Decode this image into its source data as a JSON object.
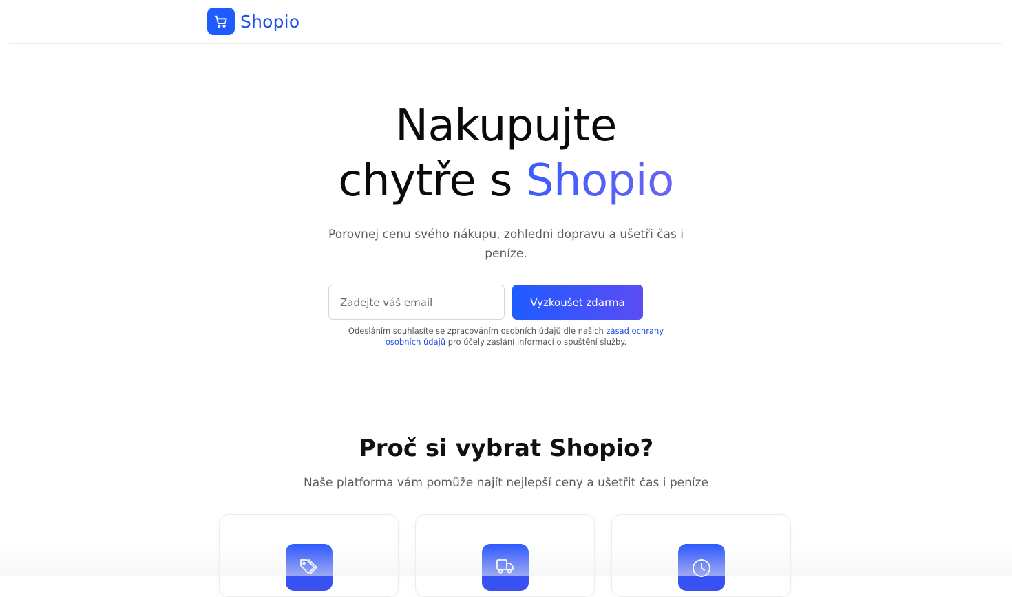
{
  "header": {
    "brand": "Shopio"
  },
  "hero": {
    "title_line1": "Nakupujte",
    "title_line2_prefix": "chytře s",
    "title_accent": "Shopio",
    "subtitle": "Porovnej cenu svého nákupu, zohledni dopravu a ušetři čas i peníze."
  },
  "signup": {
    "email_placeholder": "Zadejte váš email",
    "email_value": "",
    "button_label": "Vyzkoušet zdarma",
    "consent_prefix": "Odesláním souhlasíte se zpracováním osobních údajů dle našich",
    "consent_link": "zásad ochrany osobních údajů",
    "consent_suffix": "pro účely zaslání informací o spuštění služby."
  },
  "features": {
    "title": "Proč si vybrat Shopio?",
    "subtitle": "Naše platforma vám pomůže najít nejlepší ceny a ušetřit čas i peníze",
    "cards": [
      {
        "icon": "tags-icon"
      },
      {
        "icon": "truck-icon"
      },
      {
        "icon": "clock-icon"
      }
    ]
  },
  "colors": {
    "brand": "#1f5cff",
    "brand_text": "#1f4fe6",
    "accent_gradient_start": "#3b5bff",
    "accent_gradient_end": "#6b64f0"
  }
}
